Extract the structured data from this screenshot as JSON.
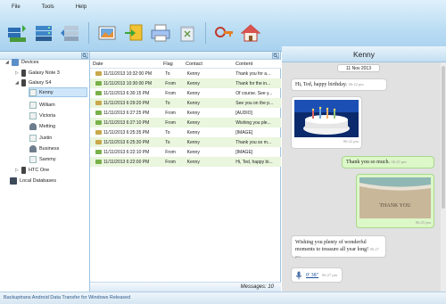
{
  "menu": [
    "File",
    "Tools",
    "Help"
  ],
  "toolbar": {
    "icons": [
      "backup-icon",
      "database-icon",
      "restore-icon",
      "photo-icon",
      "export-icon",
      "print-icon",
      "delete-icon",
      "register-icon",
      "home-icon"
    ]
  },
  "tree": {
    "root": "Devices",
    "devices": [
      {
        "label": "Galaxy Note 3"
      },
      {
        "label": "Galaxy S4"
      }
    ],
    "contacts": [
      "Kenny",
      "William",
      "Victoria",
      "Metting",
      "Justin",
      "Business",
      "Sammy"
    ],
    "other_device": "HTC One",
    "local": "Local Databases"
  },
  "list": {
    "columns": {
      "date": "Date",
      "flag": "Flag",
      "contact": "Contact",
      "content": "Content"
    },
    "rows": [
      {
        "date": "11/11/2013 10:32:00 PM",
        "flag": "To",
        "contact": "Kenny",
        "content": "Thank you for a..."
      },
      {
        "date": "11/11/2013 10:30:00 PM",
        "flag": "From",
        "contact": "Kenny",
        "content": "Thank for the in..."
      },
      {
        "date": "11/11/2013 6:30:15 PM",
        "flag": "From",
        "contact": "Kenny",
        "content": "Of course. See y..."
      },
      {
        "date": "11/11/2013 6:29:20 PM",
        "flag": "To",
        "contact": "Kenny",
        "content": "See you on the p..."
      },
      {
        "date": "11/11/2013 6:27:25 PM",
        "flag": "From",
        "contact": "Kenny",
        "content": "[AUDIO]"
      },
      {
        "date": "11/11/2013 6:27:10 PM",
        "flag": "From",
        "contact": "Kenny",
        "content": "Wishing you ple..."
      },
      {
        "date": "11/11/2013 6:25:35 PM",
        "flag": "To",
        "contact": "Kenny",
        "content": "[IMAGE]"
      },
      {
        "date": "11/11/2013 6:25:30 PM",
        "flag": "To",
        "contact": "Kenny",
        "content": "Thank you so m..."
      },
      {
        "date": "11/11/2013 6:22:10 PM",
        "flag": "From",
        "contact": "Kenny",
        "content": "[IMAGE]"
      },
      {
        "date": "11/11/2013 6:22:00 PM",
        "flag": "From",
        "contact": "Kenny",
        "content": "Hi, Ted, happy bi..."
      }
    ],
    "footer": "Messages: 10"
  },
  "chat": {
    "title": "Kenny",
    "date": "11 Nov 2013",
    "messages": [
      {
        "text": "Hi, Ted, happy birthday.",
        "time": "06:22 pm"
      },
      {
        "text": "",
        "time": "06:22 pm"
      },
      {
        "text": "Thank you so much.",
        "time": "06:25 pm"
      },
      {
        "text": "THANK YOU",
        "time": "06:25 pm"
      },
      {
        "text": "Wishing you plenty of wonderful moments to treasure all year long!",
        "time": "06:27 pm"
      },
      {
        "text": "0' 38\"",
        "time": "06:27 pm"
      }
    ]
  },
  "status": "Backuptrans Android Data Transfer for Windows Released"
}
